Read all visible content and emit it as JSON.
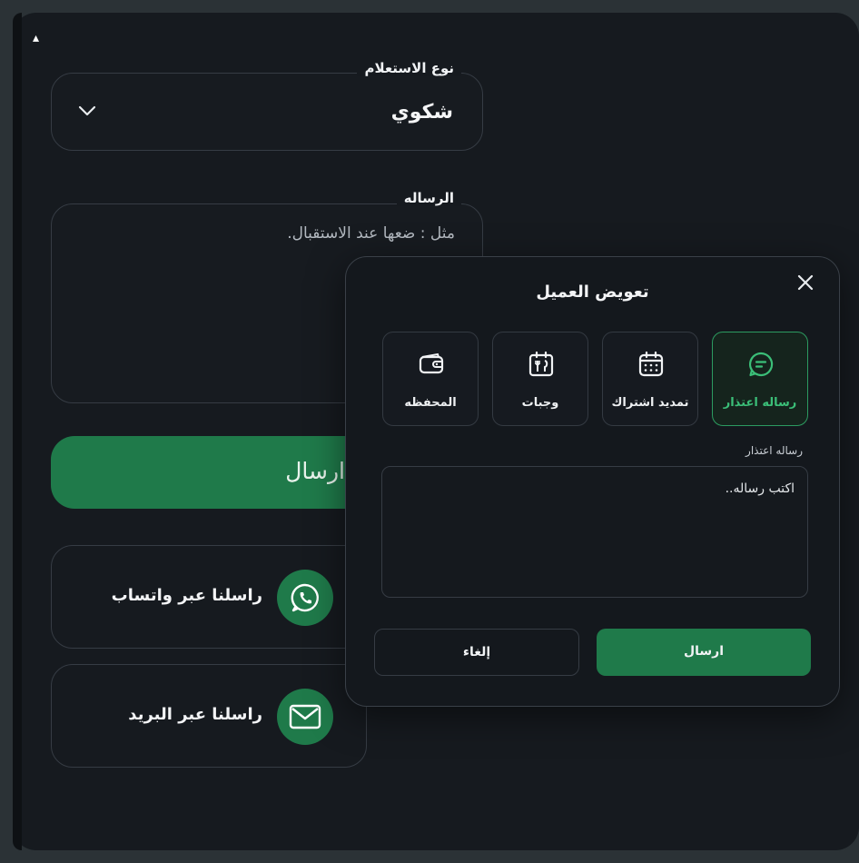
{
  "form": {
    "inquiry_type": {
      "label": "نوع الاستعلام",
      "value": "شكوي"
    },
    "message": {
      "label": "الرساله",
      "placeholder": "مثل : ضعها عند الاستقبال."
    },
    "send_label": "ارسال",
    "contacts": [
      {
        "label": "راسلنا عبر واتساب",
        "icon": "whatsapp-icon"
      },
      {
        "label": "راسلنا عبر البريد",
        "icon": "mail-icon"
      }
    ]
  },
  "modal": {
    "title": "تعويض العميل",
    "options": [
      {
        "label": "رساله اعتذار",
        "icon": "chat-message-icon",
        "active": true
      },
      {
        "label": "تمديد اشتراك",
        "icon": "calendar-icon",
        "active": false
      },
      {
        "label": "وجبات",
        "icon": "meal-icon",
        "active": false
      },
      {
        "label": "المحفظه",
        "icon": "wallet-icon",
        "active": false
      }
    ],
    "field_label": "رساله اعتذار",
    "textarea_placeholder": "اكتب رساله..",
    "submit_label": "ارسال",
    "cancel_label": "إلغاء"
  },
  "colors": {
    "accent": "#1f7a4a",
    "accent_text": "#3bbf78",
    "background": "#161a1f"
  }
}
